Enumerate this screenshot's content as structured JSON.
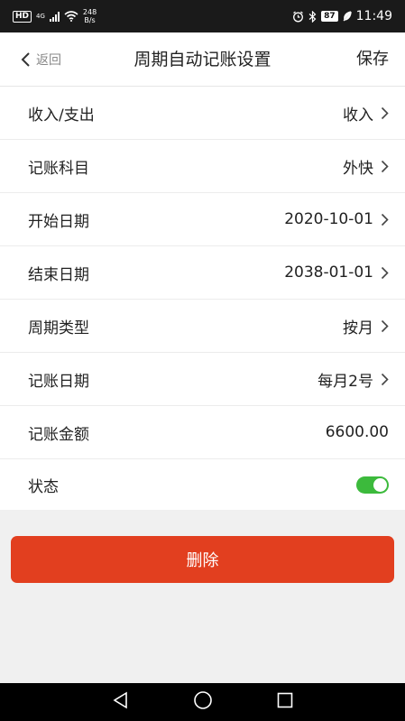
{
  "status_bar": {
    "network_badge": "HD",
    "signal_type": "4G",
    "speed_value": "248",
    "speed_unit": "B/s",
    "battery": "87",
    "time": "11:49",
    "icons": [
      "signal-icon",
      "wifi-icon",
      "alarm-icon",
      "bluetooth-icon",
      "battery-icon",
      "charging-icon"
    ]
  },
  "navbar": {
    "back_label": "返回",
    "title": "周期自动记账设置",
    "save_label": "保存"
  },
  "form": {
    "rows": [
      {
        "label": "收入/支出",
        "value": "收入"
      },
      {
        "label": "记账科目",
        "value": "外快"
      },
      {
        "label": "开始日期",
        "value": "2020-10-01"
      },
      {
        "label": "结束日期",
        "value": "2038-01-01"
      },
      {
        "label": "周期类型",
        "value": "按月"
      },
      {
        "label": "记账日期",
        "value": "每月2号"
      },
      {
        "label": "记账金额",
        "value": "6600.00"
      },
      {
        "label": "状态",
        "toggle_on": true
      }
    ]
  },
  "delete_label": "删除",
  "colors": {
    "accent_red": "#e23f1f",
    "toggle_green": "#3cba3c",
    "status_bar_bg": "#1a1a1a"
  },
  "system_nav": {
    "icons": [
      "back-triangle-icon",
      "home-circle-icon",
      "recents-square-icon"
    ]
  }
}
